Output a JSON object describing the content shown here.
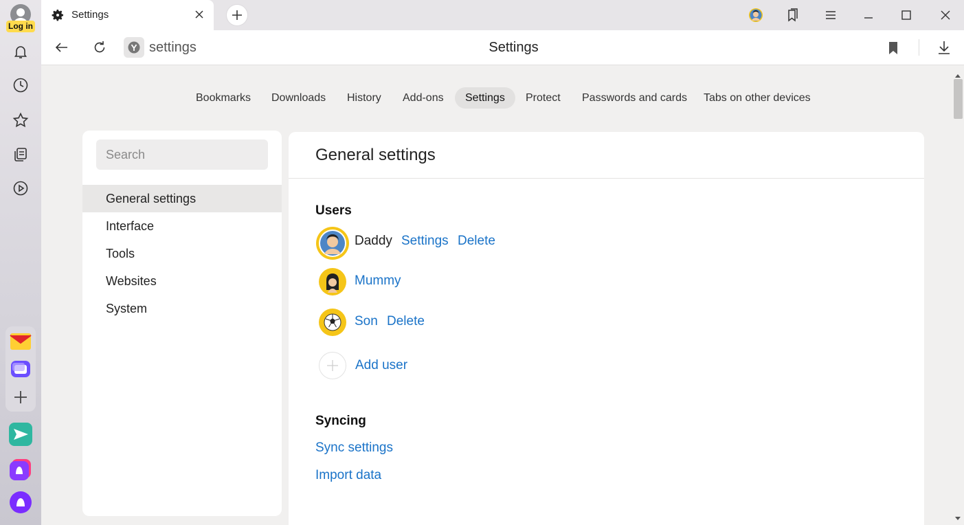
{
  "sidebar_left": {
    "login_label": "Log in"
  },
  "tab": {
    "title": "Settings"
  },
  "address": {
    "url_text": "settings",
    "page_heading": "Settings"
  },
  "topnav": {
    "tabs": [
      "Bookmarks",
      "Downloads",
      "History",
      "Add-ons",
      "Settings",
      "Protect",
      "Passwords and cards",
      "Tabs on other devices"
    ],
    "active": "Settings"
  },
  "side_menu": {
    "search_placeholder": "Search",
    "items": [
      "General settings",
      "Interface",
      "Tools",
      "Websites",
      "System"
    ],
    "active": "General settings"
  },
  "main": {
    "title": "General settings",
    "users_heading": "Users",
    "users": [
      {
        "name": "Daddy",
        "settings_label": "Settings",
        "delete_label": "Delete"
      },
      {
        "name": "Mummy"
      },
      {
        "name": "Son",
        "delete_label": "Delete"
      }
    ],
    "add_user_label": "Add user",
    "syncing_heading": "Syncing",
    "sync_settings_label": "Sync settings",
    "import_data_label": "Import data"
  },
  "colors": {
    "link": "#1a73c8",
    "accent_yellow": "#ffdb4d",
    "page_bg": "#f1f0ef"
  }
}
